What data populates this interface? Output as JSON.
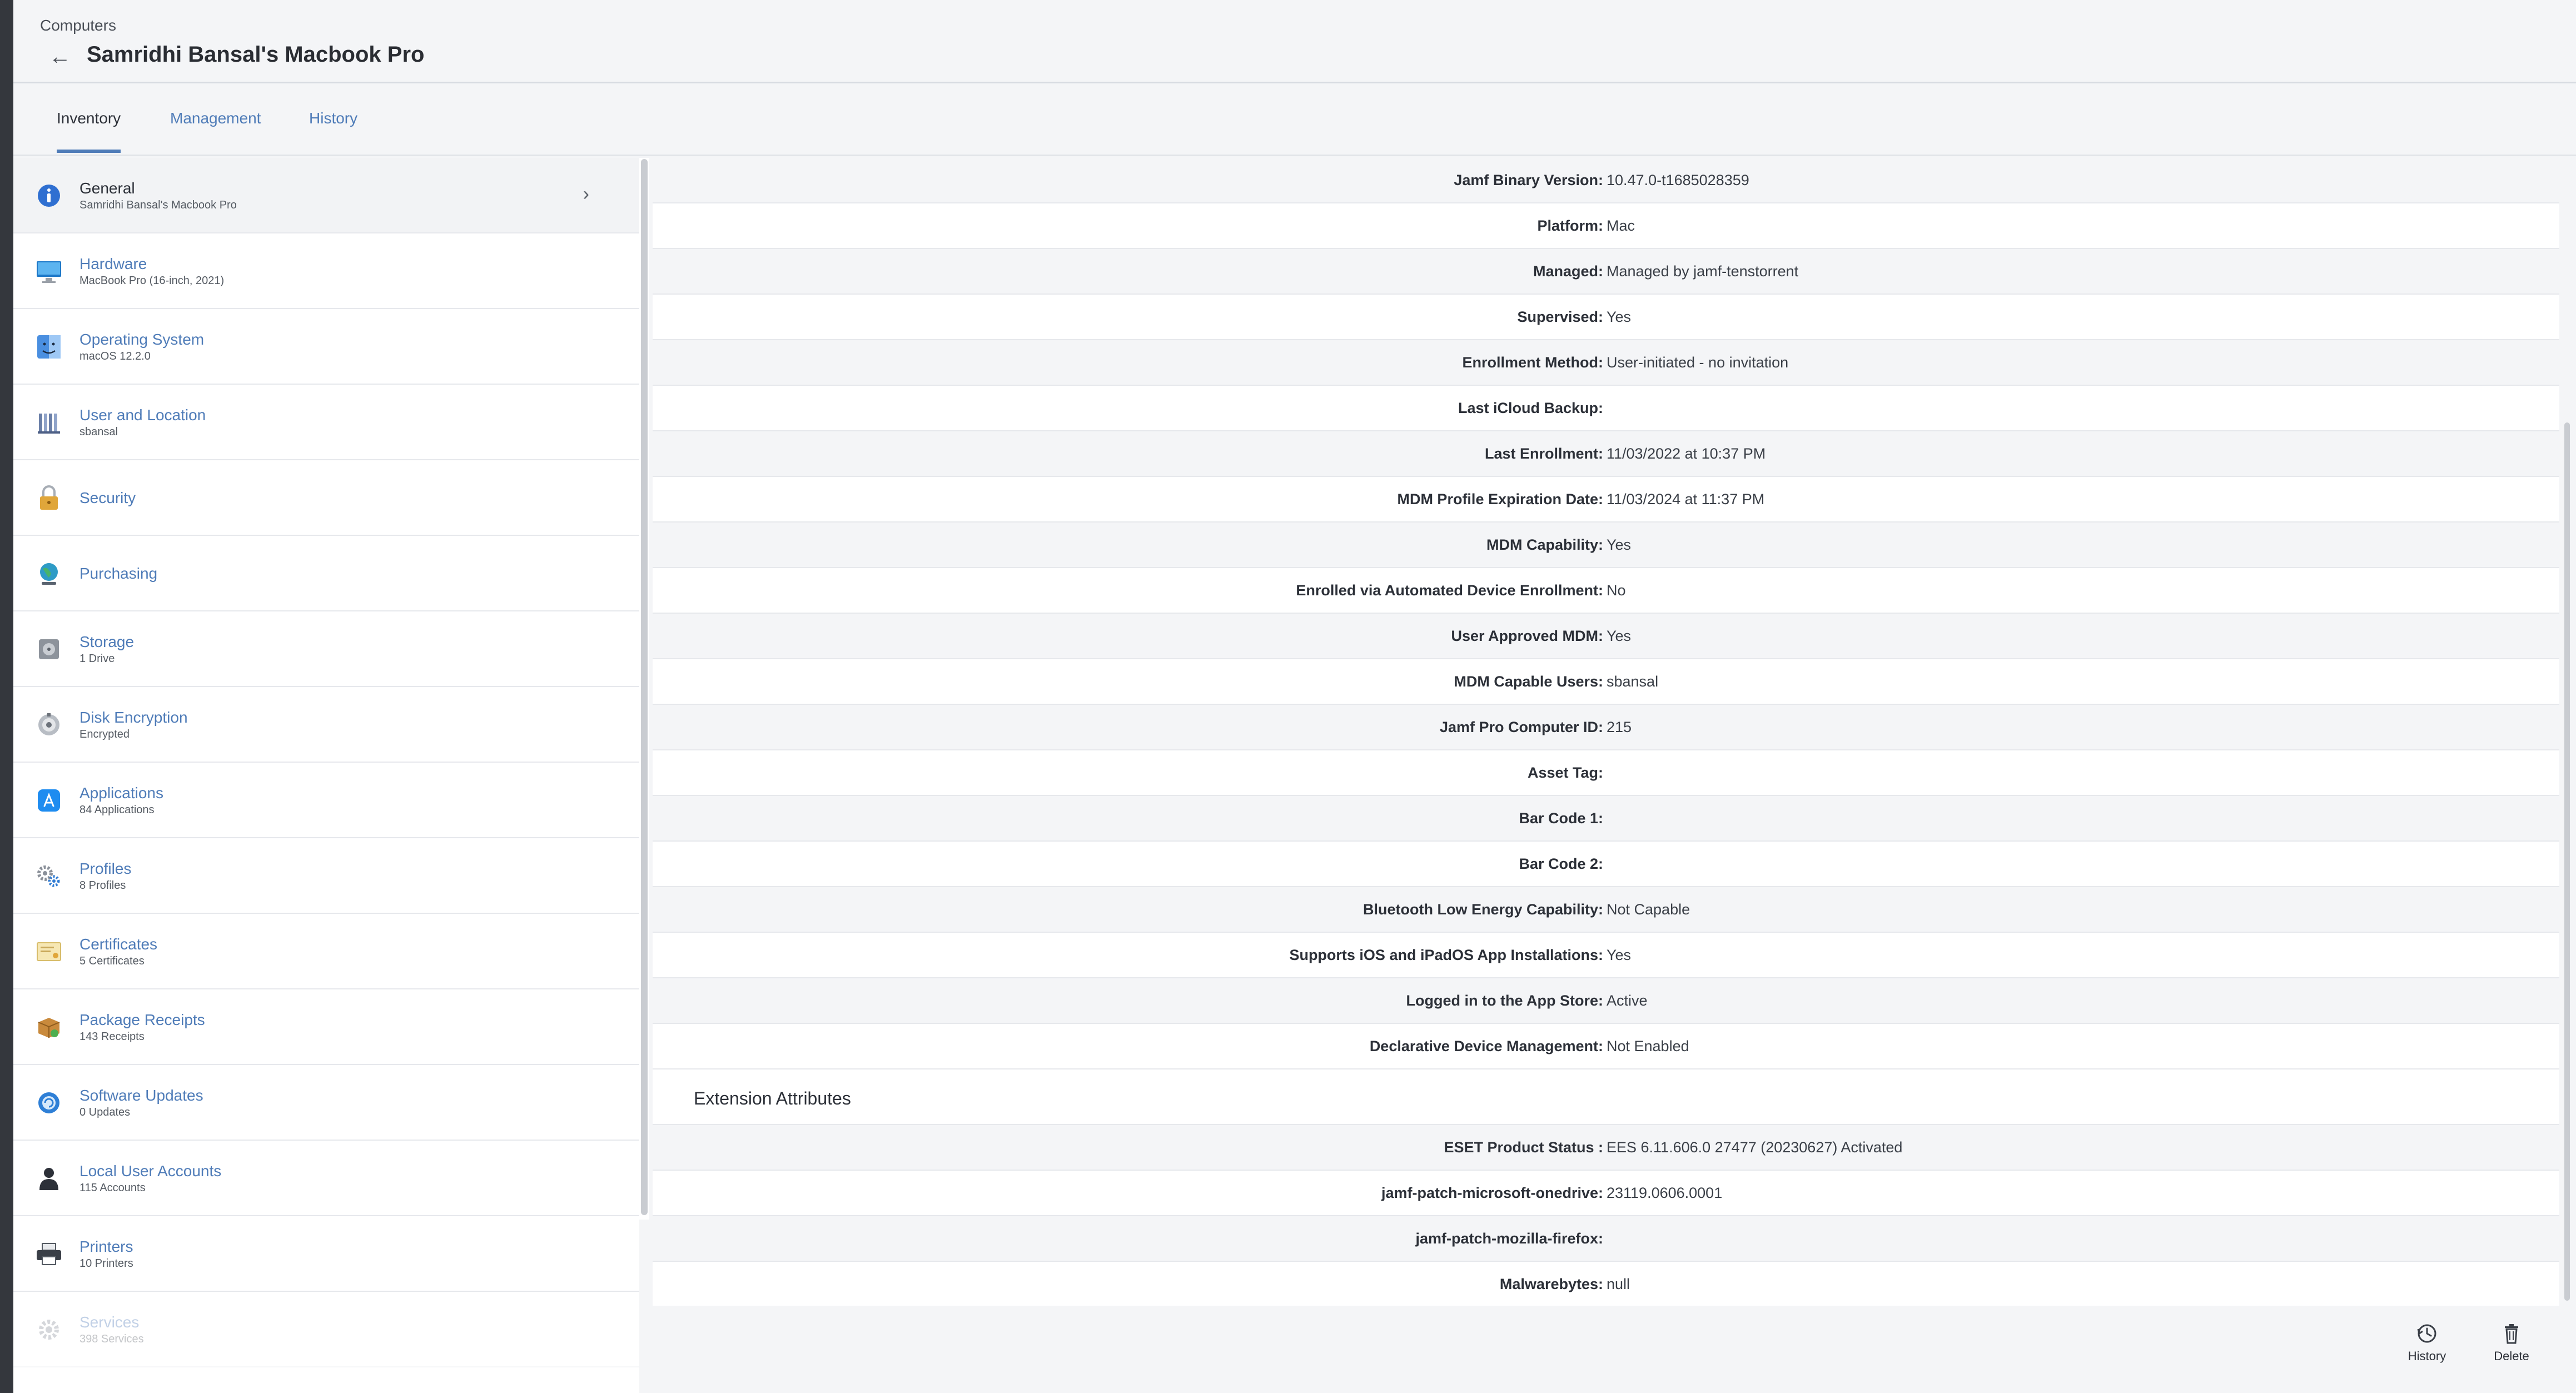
{
  "header": {
    "breadcrumb": "Computers",
    "title": "Samridhi Bansal's Macbook Pro"
  },
  "tabs": [
    {
      "label": "Inventory",
      "active": true
    },
    {
      "label": "Management",
      "active": false
    },
    {
      "label": "History",
      "active": false
    }
  ],
  "sidebar": {
    "items": [
      {
        "label": "General",
        "sub": "Samridhi Bansal's Macbook Pro",
        "icon": "info-icon"
      },
      {
        "label": "Hardware",
        "sub": "MacBook Pro (16-inch, 2021)",
        "icon": "monitor-icon"
      },
      {
        "label": "Operating System",
        "sub": "macOS 12.2.0",
        "icon": "finder-icon"
      },
      {
        "label": "User and Location",
        "sub": "sbansal",
        "icon": "user-location-icon"
      },
      {
        "label": "Security",
        "sub": "",
        "icon": "lock-icon"
      },
      {
        "label": "Purchasing",
        "sub": "",
        "icon": "globe-icon"
      },
      {
        "label": "Storage",
        "sub": "1 Drive",
        "icon": "drive-icon"
      },
      {
        "label": "Disk Encryption",
        "sub": "Encrypted",
        "icon": "vault-icon"
      },
      {
        "label": "Applications",
        "sub": "84 Applications",
        "icon": "app-store-icon"
      },
      {
        "label": "Profiles",
        "sub": "8 Profiles",
        "icon": "gears-icon"
      },
      {
        "label": "Certificates",
        "sub": "5 Certificates",
        "icon": "certificate-icon"
      },
      {
        "label": "Package Receipts",
        "sub": "143 Receipts",
        "icon": "package-icon"
      },
      {
        "label": "Software Updates",
        "sub": "0 Updates",
        "icon": "update-icon"
      },
      {
        "label": "Local User Accounts",
        "sub": "115 Accounts",
        "icon": "person-icon"
      },
      {
        "label": "Printers",
        "sub": "10 Printers",
        "icon": "printer-icon"
      },
      {
        "label": "Services",
        "sub": "398 Services",
        "icon": "gear-icon"
      }
    ]
  },
  "details": [
    {
      "label": "Jamf Binary Version:",
      "value": "10.47.0-t1685028359"
    },
    {
      "label": "Platform:",
      "value": "Mac"
    },
    {
      "label": "Managed:",
      "value": "Managed by jamf-tenstorrent"
    },
    {
      "label": "Supervised:",
      "value": "Yes"
    },
    {
      "label": "Enrollment Method:",
      "value": "User-initiated - no invitation"
    },
    {
      "label": "Last iCloud Backup:",
      "value": ""
    },
    {
      "label": "Last Enrollment:",
      "value": "11/03/2022 at 10:37 PM"
    },
    {
      "label": "MDM Profile Expiration Date:",
      "value": "11/03/2024 at 11:37 PM"
    },
    {
      "label": "MDM Capability:",
      "value": "Yes"
    },
    {
      "label": "Enrolled via Automated Device Enrollment:",
      "value": "No"
    },
    {
      "label": "User Approved MDM:",
      "value": "Yes"
    },
    {
      "label": "MDM Capable Users:",
      "value": "sbansal"
    },
    {
      "label": "Jamf Pro Computer ID:",
      "value": "215"
    },
    {
      "label": "Asset Tag:",
      "value": ""
    },
    {
      "label": "Bar Code 1:",
      "value": ""
    },
    {
      "label": "Bar Code 2:",
      "value": ""
    },
    {
      "label": "Bluetooth Low Energy Capability:",
      "value": "Not Capable"
    },
    {
      "label": "Supports iOS and iPadOS App Installations:",
      "value": "Yes"
    },
    {
      "label": "Logged in to the App Store:",
      "value": "Active"
    },
    {
      "label": "Declarative Device Management:",
      "value": "Not Enabled"
    }
  ],
  "extension_attributes": {
    "title": "Extension Attributes",
    "rows": [
      {
        "label": "ESET Product Status :",
        "value": "EES 6.11.606.0 27477 (20230627) Activated"
      },
      {
        "label": "jamf-patch-microsoft-onedrive:",
        "value": "23119.0606.0001"
      },
      {
        "label": "jamf-patch-mozilla-firefox:",
        "value": ""
      },
      {
        "label": "Malwarebytes:",
        "value": "null"
      }
    ]
  },
  "actions": {
    "history_label": "History",
    "delete_label": "Delete"
  }
}
